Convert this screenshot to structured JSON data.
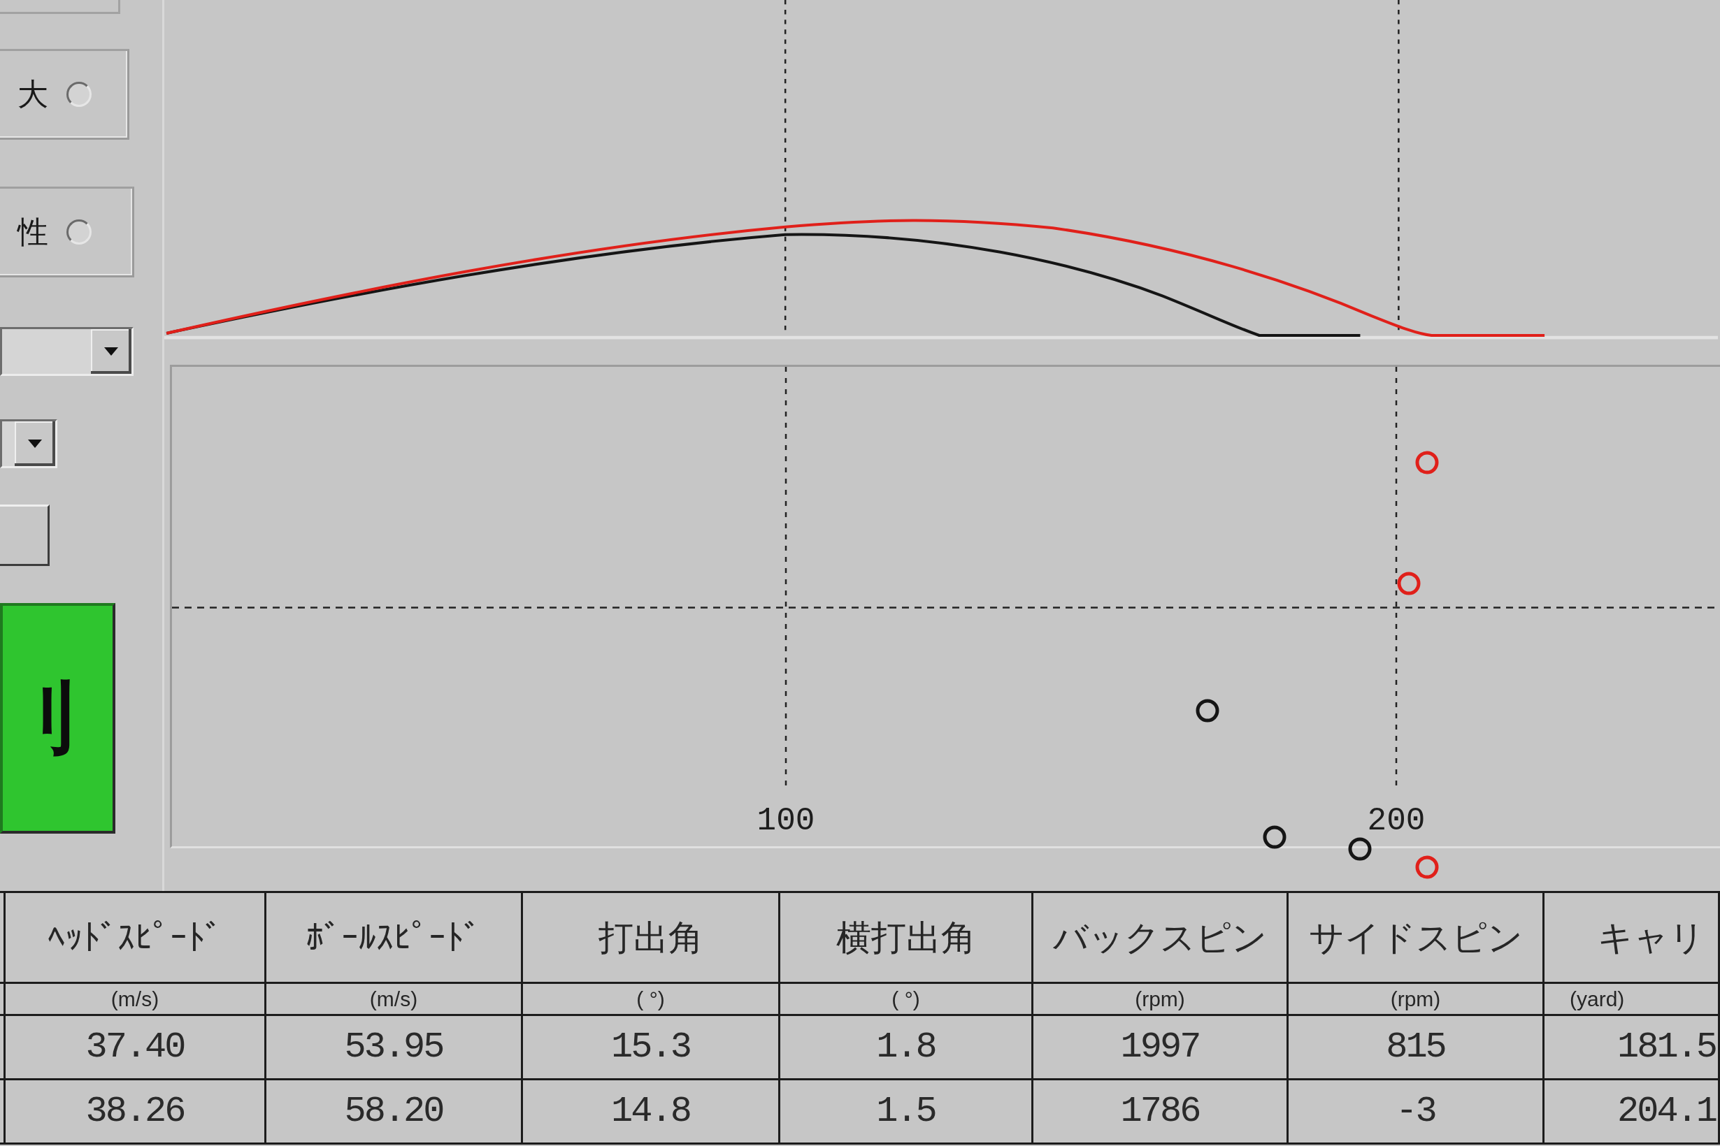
{
  "left_panel": {
    "option_groups": [
      {
        "label": "大",
        "selected": false
      },
      {
        "label": "性",
        "selected": false
      }
    ],
    "controls": [
      {
        "kind": "dropdown"
      },
      {
        "kind": "dropdown"
      },
      {
        "kind": "button"
      }
    ],
    "action_button": {
      "label": "刂"
    }
  },
  "trajectory_chart": {
    "lines": [
      {
        "color": "#151515"
      },
      {
        "color": "#e0201a"
      }
    ]
  },
  "landing_chart": {
    "distance_labels": [
      "100",
      "200"
    ],
    "marks": [
      {
        "color": "#151515"
      },
      {
        "color": "#151515"
      },
      {
        "color": "#151515"
      },
      {
        "color": "#e0201a"
      },
      {
        "color": "#e0201a"
      },
      {
        "color": "#e0201a"
      }
    ]
  },
  "table": {
    "columns": [
      {
        "label": "ﾍｯﾄﾞｽﾋﾟｰﾄﾞ",
        "unit": "(m/s)"
      },
      {
        "label": "ﾎﾞｰﾙｽﾋﾟｰﾄﾞ",
        "unit": "(m/s)"
      },
      {
        "label": "打出角",
        "unit": "( °)"
      },
      {
        "label": "横打出角",
        "unit": "( °)"
      },
      {
        "label": "バックスピン",
        "unit": "(rpm)"
      },
      {
        "label": "サイドスピン",
        "unit": "(rpm)"
      },
      {
        "label": "キャリ",
        "unit": "(yard)"
      }
    ],
    "rows": [
      [
        "37.40",
        "53.95",
        "15.3",
        "1.8",
        "1997",
        "815",
        "181.5"
      ],
      [
        "38.26",
        "58.20",
        "14.8",
        "1.5",
        "1786",
        "-3",
        "204.1"
      ]
    ]
  }
}
